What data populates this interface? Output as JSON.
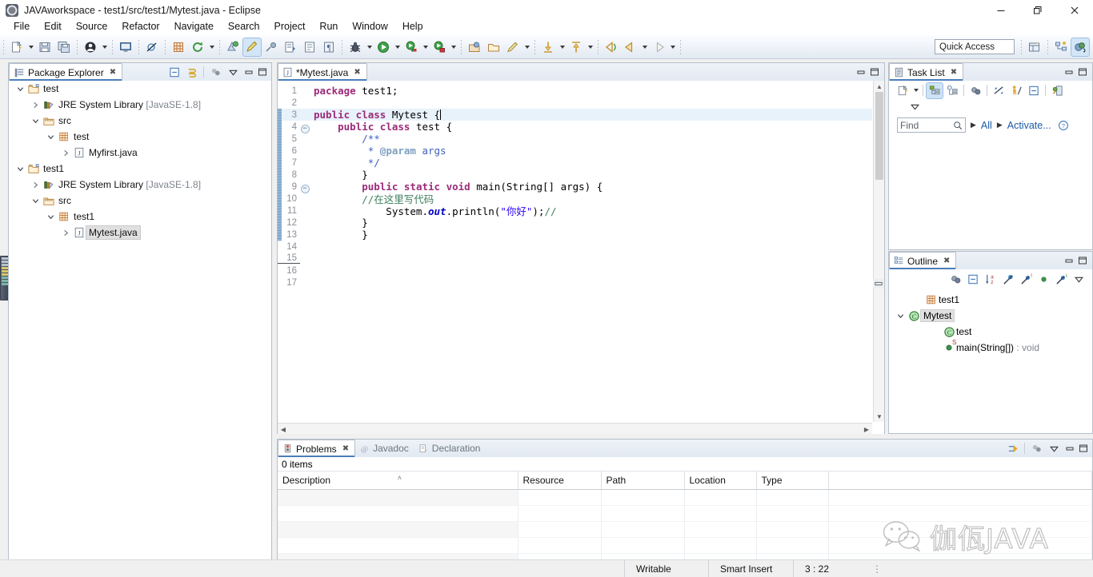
{
  "window": {
    "title": "JAVAworkspace - test1/src/test1/Mytest.java - Eclipse",
    "app_icon": "eclipse-icon",
    "minimize": "—",
    "maximize": "❐",
    "close": "✕"
  },
  "menubar": {
    "items": [
      "File",
      "Edit",
      "Source",
      "Refactor",
      "Navigate",
      "Search",
      "Project",
      "Run",
      "Window",
      "Help"
    ]
  },
  "toolbar": {
    "quick_access_placeholder": "Quick Access",
    "groups": [
      {
        "buttons": [
          {
            "name": "new-wizard-icon",
            "kind": "new",
            "dropdown": true
          },
          {
            "name": "save-icon",
            "kind": "save"
          },
          {
            "name": "save-all-icon",
            "kind": "saveall"
          }
        ]
      },
      {
        "buttons": [
          {
            "name": "user-profile-icon",
            "kind": "user",
            "dropdown": true
          }
        ]
      },
      {
        "buttons": [
          {
            "name": "console-icon",
            "kind": "console"
          }
        ]
      },
      {
        "buttons": [
          {
            "name": "skip-breakpoints-icon",
            "kind": "skipbp"
          }
        ]
      },
      {
        "buttons": [
          {
            "name": "new-java-package-icon",
            "kind": "package"
          },
          {
            "name": "refresh-icon",
            "kind": "refresh",
            "dropdown": true
          }
        ]
      },
      {
        "buttons": [
          {
            "name": "debug-last-icon",
            "kind": "debuglast"
          },
          {
            "name": "edit-marker-icon",
            "kind": "editmark",
            "selected": true
          },
          {
            "name": "link-icon",
            "kind": "link"
          },
          {
            "name": "open-task-icon",
            "kind": "opentask"
          },
          {
            "name": "show-whitespace-icon",
            "kind": "whitespace"
          },
          {
            "name": "paragraph-mark-icon",
            "kind": "pilcrow"
          }
        ]
      },
      {
        "buttons": [
          {
            "name": "debug-icon",
            "kind": "bug",
            "dropdown": true
          },
          {
            "name": "run-icon",
            "kind": "run",
            "dropdown": true
          },
          {
            "name": "run-configuration-icon",
            "kind": "runcfg",
            "dropdown": true
          },
          {
            "name": "coverage-icon",
            "kind": "coverage",
            "dropdown": true
          }
        ]
      },
      {
        "buttons": [
          {
            "name": "open-type-icon",
            "kind": "opentype"
          },
          {
            "name": "open-task-folder-icon",
            "kind": "folder"
          },
          {
            "name": "search-pencil-icon",
            "kind": "pencil",
            "dropdown": true
          }
        ]
      },
      {
        "buttons": [
          {
            "name": "next-annotation-icon",
            "kind": "nextann",
            "dropdown": true
          },
          {
            "name": "previous-annotation-icon",
            "kind": "prevann",
            "dropdown": true
          }
        ]
      },
      {
        "buttons": [
          {
            "name": "back-history-icon",
            "kind": "backhist"
          },
          {
            "name": "back-icon",
            "kind": "back",
            "dropdown": true
          },
          {
            "name": "forward-icon",
            "kind": "forward",
            "dropdown": true
          }
        ]
      }
    ],
    "perspective": [
      {
        "name": "open-perspective-icon",
        "kind": "openpersp"
      },
      {
        "name": "java-browsing-perspective-icon",
        "kind": "browsing"
      },
      {
        "name": "java-perspective-icon",
        "kind": "javapersp",
        "selected": true
      }
    ]
  },
  "package_explorer": {
    "tab_label": "Package Explorer",
    "tab_icon": "package-explorer-icon",
    "close_mark": "✖",
    "toolbar": [
      {
        "name": "collapse-all-icon"
      },
      {
        "name": "link-with-editor-icon"
      },
      {
        "name": "view-menu-icon"
      },
      {
        "name": "minimize-view-icon"
      },
      {
        "name": "maximize-view-icon"
      }
    ],
    "tree": [
      {
        "depth": 0,
        "twisty": "open",
        "icon": "project-icon",
        "label": "test",
        "suffix": ""
      },
      {
        "depth": 1,
        "twisty": "closed",
        "icon": "library-icon",
        "label": "JRE System Library",
        "suffix": "[JavaSE-1.8]"
      },
      {
        "depth": 1,
        "twisty": "open",
        "icon": "source-folder-icon",
        "label": "src",
        "suffix": ""
      },
      {
        "depth": 2,
        "twisty": "open",
        "icon": "package-icon",
        "label": "test",
        "suffix": ""
      },
      {
        "depth": 3,
        "twisty": "closed",
        "icon": "java-file-icon",
        "label": "Myfirst.java",
        "suffix": ""
      },
      {
        "depth": 0,
        "twisty": "open",
        "icon": "project-icon",
        "label": "test1",
        "suffix": ""
      },
      {
        "depth": 1,
        "twisty": "closed",
        "icon": "library-icon",
        "label": "JRE System Library",
        "suffix": "[JavaSE-1.8]"
      },
      {
        "depth": 1,
        "twisty": "open",
        "icon": "source-folder-icon",
        "label": "src",
        "suffix": ""
      },
      {
        "depth": 2,
        "twisty": "open",
        "icon": "package-icon",
        "label": "test1",
        "suffix": ""
      },
      {
        "depth": 3,
        "twisty": "closed",
        "icon": "java-file-icon",
        "label": "Mytest.java",
        "suffix": "",
        "selected": true
      }
    ]
  },
  "editor": {
    "tab_label": "*Mytest.java",
    "tab_icon": "java-file-icon",
    "close_mark": "✖",
    "minimize": "—",
    "maximize": "❐",
    "lines": [
      {
        "num": 1,
        "fold": "",
        "changed": false,
        "html": "<span class=\"kw\">package</span> test1;"
      },
      {
        "num": 2,
        "fold": "",
        "changed": false,
        "html": ""
      },
      {
        "num": 3,
        "fold": "",
        "changed": true,
        "current": true,
        "html": "<span class=\"kw\">public class</span> Mytest {<span class=\"caret\"></span>"
      },
      {
        "num": 4,
        "fold": "minus",
        "changed": true,
        "html": "    <span class=\"kw\">public class</span> test {"
      },
      {
        "num": 5,
        "fold": "",
        "changed": true,
        "html": "        <span class=\"jdoc\">/**</span>"
      },
      {
        "num": 6,
        "fold": "",
        "changed": true,
        "html": "         <span class=\"jdoc\">* </span><span class=\"jtag\">@param</span><span class=\"jdoc\"> args</span>"
      },
      {
        "num": 7,
        "fold": "",
        "changed": true,
        "html": "         <span class=\"jdoc\">*/</span>"
      },
      {
        "num": 8,
        "fold": "",
        "changed": true,
        "html": "        }"
      },
      {
        "num": 9,
        "fold": "minus",
        "changed": true,
        "html": "        <span class=\"kw\">public static void</span> main(String[] args) {"
      },
      {
        "num": 10,
        "fold": "",
        "changed": true,
        "html": "        <span class=\"cmt\">//在这里写代码</span>"
      },
      {
        "num": 11,
        "fold": "",
        "changed": true,
        "html": "            System.<span class=\"fld\">out</span>.println(<span class=\"str\">\"你好\"</span>);<span class=\"cmt\">//</span>"
      },
      {
        "num": 12,
        "fold": "",
        "changed": true,
        "html": "        }"
      },
      {
        "num": 13,
        "fold": "",
        "changed": true,
        "html": "        }"
      },
      {
        "num": 14,
        "fold": "",
        "changed": false,
        "html": ""
      },
      {
        "num": 15,
        "fold": "",
        "changed": false,
        "html": ""
      },
      {
        "num": 16,
        "fold": "",
        "changed": false,
        "html": ""
      },
      {
        "num": 17,
        "fold": "",
        "changed": false,
        "html": ""
      }
    ]
  },
  "problems": {
    "tabs": [
      {
        "label": "Problems",
        "icon": "problems-icon",
        "active": true,
        "close_mark": "✖"
      },
      {
        "label": "Javadoc",
        "icon": "javadoc-icon",
        "active": false
      },
      {
        "label": "Declaration",
        "icon": "declaration-icon",
        "active": false
      }
    ],
    "toolbar": [
      {
        "name": "focus-on-selection-icon"
      },
      {
        "name": "filters-icon"
      },
      {
        "name": "view-menu-icon"
      },
      {
        "name": "minimize-view-icon"
      },
      {
        "name": "maximize-view-icon"
      }
    ],
    "item_count_label": "0 items",
    "columns": [
      "Description",
      "Resource",
      "Path",
      "Location",
      "Type"
    ],
    "sorted_column": "Description",
    "sort_direction": "˄",
    "rows": []
  },
  "task_list": {
    "tab_label": "Task List",
    "tab_icon": "task-list-icon",
    "close_mark": "✖",
    "minimize": "—",
    "maximize": "❐",
    "toolbar": [
      {
        "name": "new-task-icon",
        "dropdown": true
      },
      {
        "name": "categorized-presentation-icon",
        "selected": true
      },
      {
        "name": "scheduled-presentation-icon"
      },
      {
        "name": "focus-on-workweek-icon"
      },
      {
        "name": "synchronize-changed-icon"
      },
      {
        "name": "activate-task-icon"
      },
      {
        "name": "collapse-all-icon"
      },
      {
        "name": "open-repository-task-icon"
      },
      {
        "name": "view-menu-icon"
      }
    ],
    "find_placeholder": "Find",
    "find_value": "",
    "search_icon": "search-icon",
    "filter_all_label": "All",
    "filter_activate_label": "Activate...",
    "help_icon": "help-icon"
  },
  "outline": {
    "tab_label": "Outline",
    "tab_icon": "outline-icon",
    "close_mark": "✖",
    "minimize": "—",
    "maximize": "❐",
    "toolbar": [
      {
        "name": "focus-on-active-task-icon"
      },
      {
        "name": "collapse-all-icon"
      },
      {
        "name": "sort-icon"
      },
      {
        "name": "hide-fields-icon"
      },
      {
        "name": "hide-static-icon"
      },
      {
        "name": "hide-non-public-icon"
      },
      {
        "name": "hide-local-types-icon"
      },
      {
        "name": "view-menu-icon"
      }
    ],
    "tree": [
      {
        "depth": 1,
        "twisty": "",
        "icon": "package-icon",
        "label": "test1",
        "suffix": ""
      },
      {
        "depth": 0,
        "twisty": "open",
        "icon": "class-public-icon",
        "label": "Mytest",
        "suffix": "",
        "selected": true
      },
      {
        "depth": 2,
        "twisty": "",
        "icon": "class-public-icon",
        "label": "test",
        "suffix": ""
      },
      {
        "depth": 2,
        "twisty": "",
        "icon": "method-public-static-icon",
        "label": "main(String[])",
        "suffix": ": void"
      }
    ]
  },
  "statusbar": {
    "writable": "Writable",
    "insert_mode": "Smart Insert",
    "position": "3 : 22",
    "resize_grip": "⋮"
  },
  "watermark": {
    "icon": "wechat-icon",
    "text": "伽佤JAVA"
  },
  "colors": {
    "accent": "#1c5aa6",
    "keyword": "#9b2b79",
    "string": "#2a00ff",
    "comment": "#3f7f5f",
    "javadoc": "#3f5fbf",
    "field": "#0000c0",
    "panel_border": "#b6bfca",
    "current_line": "#e8f2fb",
    "selection": "#e0e0e0"
  }
}
